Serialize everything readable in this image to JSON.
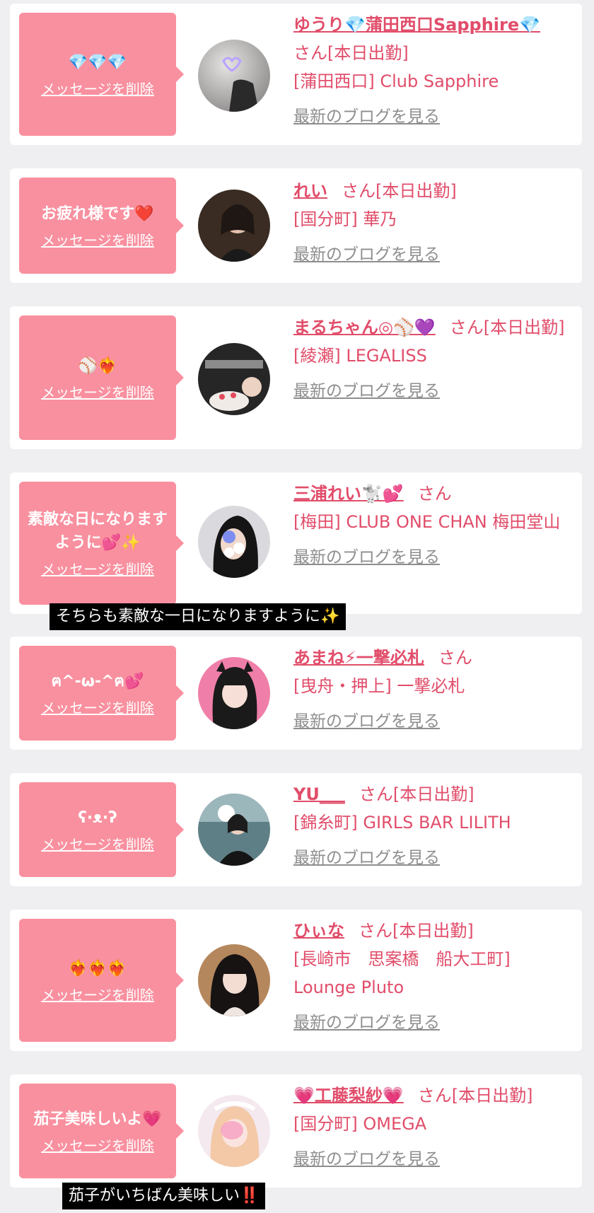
{
  "delete_label": "メッセージを削除",
  "blog_label": "最新のブログを見る",
  "colors": {
    "accent": "#e14d6a",
    "bubble": "#f9909f",
    "blog_link": "#8e8e8e",
    "background": "#efeff2"
  },
  "entries": [
    {
      "message": "💎💎💎",
      "name": "ゆうり💎蒲田西口Sapphire💎",
      "suffix": "さん[本日出勤]",
      "shop": "[蒲田西口] Club Sapphire"
    },
    {
      "message": "お疲れ様です❤️",
      "name": "れい",
      "suffix": "さん[本日出勤]",
      "shop": "[国分町] 華乃"
    },
    {
      "message": "⚾️❤️‍🔥",
      "name": "まるちゃん◎⚾️💜",
      "suffix": "さん[本日出勤]",
      "shop": "[綾瀬] LEGALISS"
    },
    {
      "message": "素敵な日になりますように💕✨",
      "name": "三浦れい🐩💕",
      "suffix": "さん",
      "shop": "[梅田] CLUB ONE CHAN 梅田堂山",
      "reply": "そちらも素敵な一日になりますように✨"
    },
    {
      "message": "ฅ^-ω-^ฅ💕",
      "name": "あまね⚡一撃必札",
      "suffix": "さん",
      "shop": "[曳舟・押上] 一撃必札"
    },
    {
      "message": "ʕ·ᴥ·ʔ",
      "name": "YU___",
      "suffix": "さん[本日出勤]",
      "shop": "[錦糸町] GIRLS BAR LILITH"
    },
    {
      "message": "❤️‍🔥❤️‍🔥❤️‍🔥",
      "name": "ひぃな",
      "suffix": "さん[本日出勤]",
      "shop": "[長崎市　思案橋　船大工町] Lounge Pluto"
    },
    {
      "message": "茄子美味しいよ💗",
      "name": "💗工藤梨紗💗",
      "suffix": "さん[本日出勤]",
      "shop": "[国分町] OMEGA",
      "reply": "茄子がいちばん美味しい‼️"
    }
  ]
}
